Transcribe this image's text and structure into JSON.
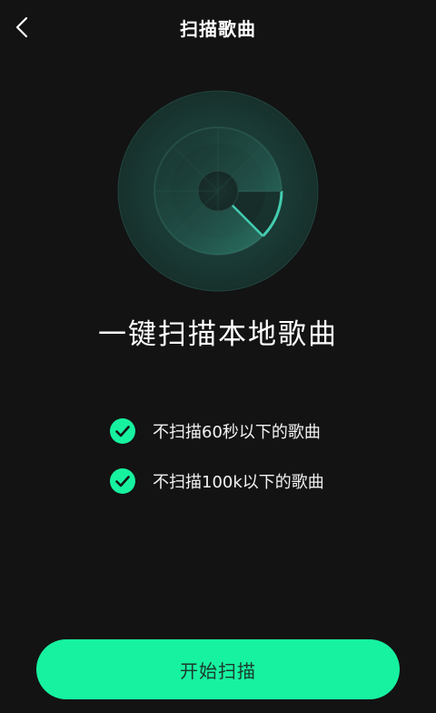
{
  "header": {
    "title": "扫描歌曲"
  },
  "main": {
    "headline": "一键扫描本地歌曲",
    "options": [
      {
        "label": "不扫描60秒以下的歌曲",
        "checked": true
      },
      {
        "label": "不扫描100k以下的歌曲",
        "checked": true
      }
    ],
    "start_button": "开始扫描"
  },
  "colors": {
    "accent": "#17f2a0",
    "background": "#131313",
    "radar_ring": "#3ec7aa"
  },
  "icons": {
    "back": "chevron-left-icon",
    "check": "check-circle-icon",
    "scan": "radar-scan-icon"
  }
}
